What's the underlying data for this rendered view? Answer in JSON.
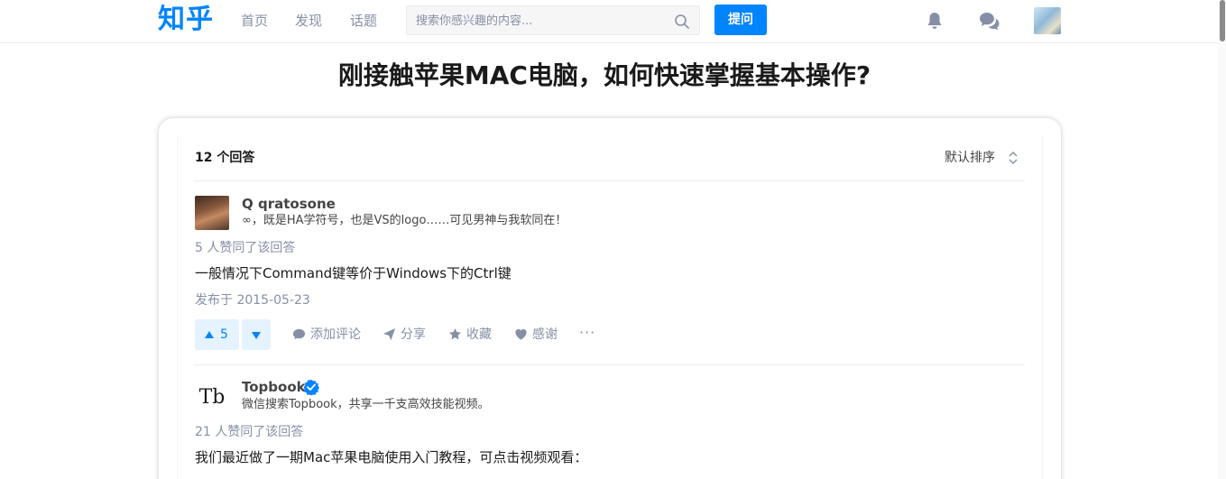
{
  "header": {
    "logo": "知乎",
    "nav": [
      "首页",
      "发现",
      "话题"
    ],
    "search_placeholder": "搜索你感兴趣的内容...",
    "ask_label": "提问",
    "icons": [
      "search-icon",
      "bell-icon",
      "chat-bubbles-icon",
      "user-avatar"
    ]
  },
  "question": {
    "title": "刚接触苹果MAC电脑，如何快速掌握基本操作?"
  },
  "list": {
    "answer_count": "12 个回答",
    "sort_label": "默认排序"
  },
  "answers": [
    {
      "author": "Q qratosone",
      "bio": "∞，既是HA学符号，也是VS的logo……可见男神与我软同在！",
      "votes_text": "5 人赞同了该回答",
      "content": "一般情况下Command键等价于Windows下的Ctrl键",
      "date": "发布于 2015-05-23",
      "upvote_count": "5",
      "actions": [
        "添加评论",
        "分享",
        "收藏",
        "感谢"
      ],
      "more": "···"
    },
    {
      "author": "Topbook",
      "logo_text": "Tb",
      "verified": true,
      "bio": "微信搜索Topbook，共享一千支高效技能视频。",
      "votes_text": "21 人赞同了该回答",
      "content": "我们最近做了一期Mac苹果电脑使用入门教程，可点击视频观看："
    }
  ],
  "colors": {
    "brand": "#0084ff",
    "muted": "#8590a6",
    "upvote_bg": "#e5f2ff"
  }
}
